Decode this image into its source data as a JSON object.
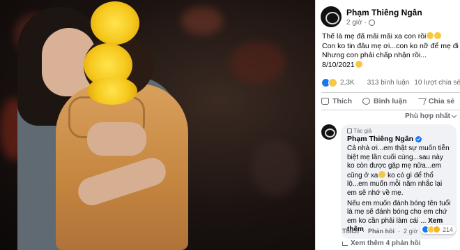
{
  "post": {
    "author": "Phạm Thiêng Ngân",
    "time": "2 giờ ·",
    "text_lines": [
      "Thế là mẹ đã mãi mãi xa con rồi",
      "Con ko tin đâu mẹ ơi...con ko nỡ để mẹ đi",
      "Nhưng con phải chấp nhận rồi...",
      "8/10/2021"
    ],
    "reactions_count": "2,3K",
    "comments_count": "313 bình luận",
    "shares_count": "10 lượt chia sẻ"
  },
  "actions": {
    "like": "Thích",
    "comment": "Bình luận",
    "share": "Chia sẻ"
  },
  "sort": {
    "label": "Phù hợp nhất"
  },
  "comment": {
    "badge": "Tác giả",
    "author": "Phạm Thiêng Ngân",
    "text_p1": "Cả nhà ơi...em thật sự muốn tiễn biệt mẹ lần cuối cùng...sau này ko còn được gặp mẹ nữa...em cũng ở xa",
    "text_p1b": "ko có gì để thổ lộ...em muốn mỗi năm nhắc lại em sẽ nhớ về mẹ.",
    "text_p2": "Nếu em muốn đánh bóng tên tuổi là mẹ sẽ đánh bóng cho em chứ em ko cần phải làm cái ...",
    "see_more": "Xem thêm",
    "like": "Thích",
    "reply": "Phản hồi",
    "time": "2 giờ",
    "reactions_count": "214",
    "more_replies": "Xem thêm 4 phản hồi"
  },
  "colors": {
    "like_blue": "#1877f2",
    "text_secondary": "#65676b",
    "bubble": "#f0f2f5"
  }
}
